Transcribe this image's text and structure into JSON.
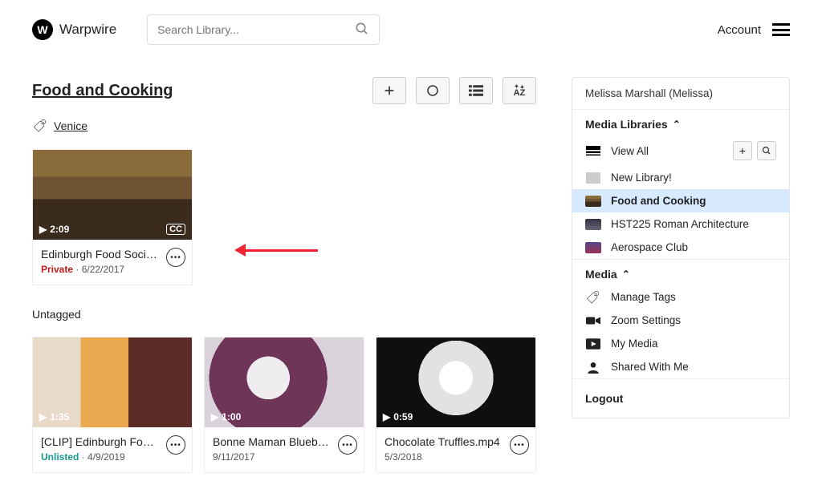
{
  "brand": "Warpwire",
  "search": {
    "placeholder": "Search Library..."
  },
  "account": {
    "label": "Account"
  },
  "page": {
    "title": "Food and Cooking"
  },
  "tag": {
    "label": "Venice"
  },
  "untagged_label": "Untagged",
  "video_featured": {
    "duration": "2:09",
    "cc": "CC",
    "title": "Edinburgh Food Soci…",
    "status": "Private",
    "date": "6/22/2017",
    "sep": " · "
  },
  "videos": [
    {
      "duration": "1:35",
      "title": "[CLIP] Edinburgh Fo…",
      "status": "Unlisted",
      "date": "4/9/2019",
      "sep": " · "
    },
    {
      "duration": "1:00",
      "title": "Bonne Maman Blueb…",
      "status": "",
      "date": "9/11/2017",
      "sep": ""
    },
    {
      "duration": "0:59",
      "title": "Chocolate Truffles.mp4",
      "status": "",
      "date": "5/3/2018",
      "sep": ""
    }
  ],
  "sidebar": {
    "user": "Melissa Marshall (Melissa)",
    "libraries_header": "Media Libraries",
    "media_header": "Media",
    "libs": [
      {
        "label": "View All"
      },
      {
        "label": "New Library!"
      },
      {
        "label": "Food and Cooking"
      },
      {
        "label": "HST225 Roman Architecture"
      },
      {
        "label": "Aerospace Club"
      }
    ],
    "media": [
      {
        "label": "Manage Tags"
      },
      {
        "label": "Zoom Settings"
      },
      {
        "label": "My Media"
      },
      {
        "label": "Shared With Me"
      }
    ],
    "logout": "Logout"
  }
}
